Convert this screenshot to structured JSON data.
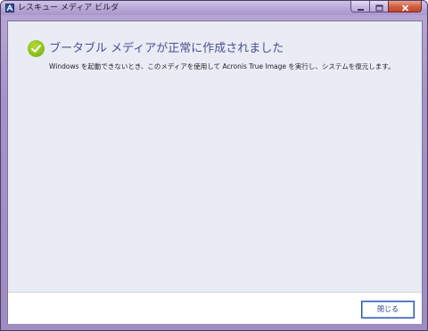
{
  "window": {
    "title": "レスキュー メディア ビルダ",
    "app_icon": "acronis-a-icon"
  },
  "caption_buttons": {
    "minimize_icon": "minimize-icon",
    "maximize_icon": "maximize-icon",
    "close_icon": "close-icon"
  },
  "main": {
    "status_icon": "check-circle-icon",
    "heading": "ブータブル メディアが正常に作成されました",
    "description": "Windows を起動できないとき、このメディアを使用して Acronis True Image を実行し、システムを復元します。"
  },
  "footer": {
    "close_label": "閉じる"
  },
  "colors": {
    "accent_heading": "#4a4f93",
    "success_green": "#8ec31c",
    "button_border": "#2e50a8",
    "client_background": "#e9ecf4"
  }
}
